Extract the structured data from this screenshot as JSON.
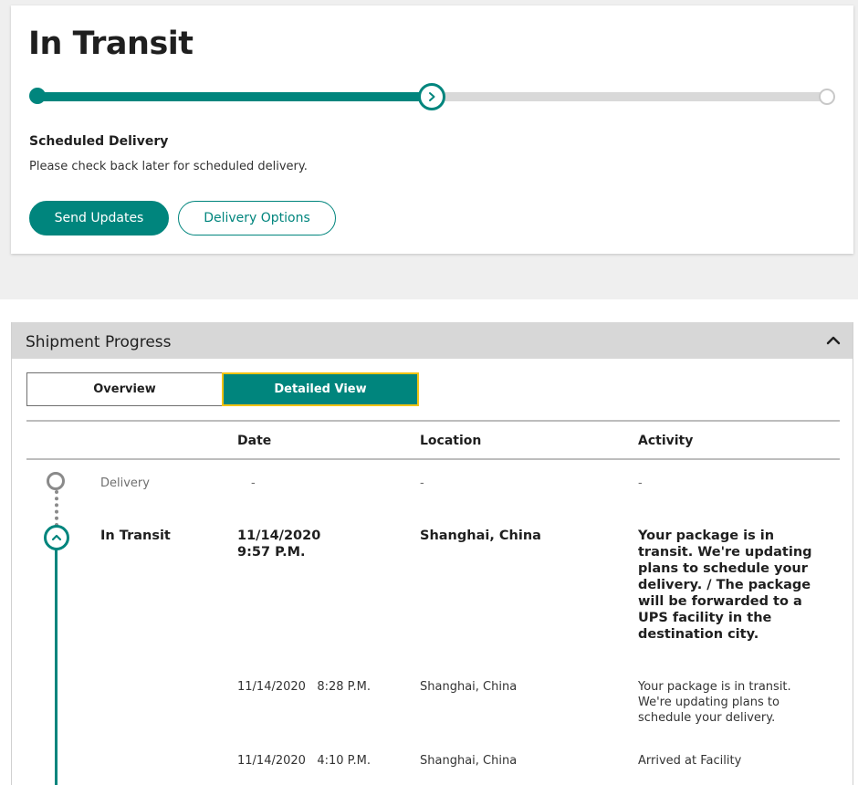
{
  "status": {
    "title": "In Transit",
    "progress": 0.5,
    "scheduled_title": "Scheduled Delivery",
    "scheduled_text": "Please check back later for scheduled delivery.",
    "buttons": {
      "send_updates": "Send Updates",
      "delivery_options": "Delivery Options"
    }
  },
  "progress_panel": {
    "title": "Shipment Progress",
    "tabs": {
      "overview": "Overview",
      "detailed": "Detailed View"
    },
    "columns": {
      "date": "Date",
      "location": "Location",
      "activity": "Activity"
    },
    "rows": [
      {
        "milestone": "Delivery",
        "date": "-",
        "location": "-",
        "activity": "-"
      },
      {
        "milestone": "In Transit",
        "date": "11/14/2020\n9:57 P.M.",
        "location": "Shanghai, China",
        "activity": "Your package is in transit. We're updating plans to schedule your delivery. / The package will be forwarded to a UPS facility in the destination city."
      },
      {
        "milestone": "",
        "date": "11/14/2020   8:28 P.M.",
        "location": "Shanghai, China",
        "activity": "Your package is in transit. We're updating plans to schedule your delivery."
      },
      {
        "milestone": "",
        "date": "11/14/2020   4:10 P.M.",
        "location": "Shanghai, China",
        "activity": "Arrived at Facility"
      }
    ]
  },
  "colors": {
    "accent": "#00857d",
    "focus": "#f2c314",
    "header_bg": "#d7d7d7",
    "page_bg": "#efefef"
  }
}
